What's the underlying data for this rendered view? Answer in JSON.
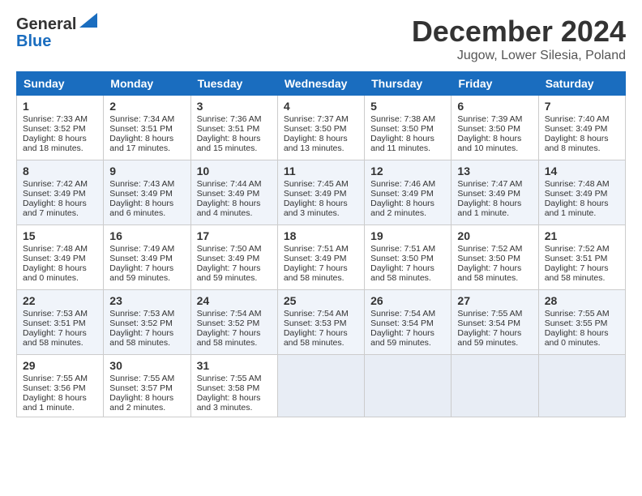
{
  "logo": {
    "general": "General",
    "blue": "Blue"
  },
  "header": {
    "month": "December 2024",
    "location": "Jugow, Lower Silesia, Poland"
  },
  "days_of_week": [
    "Sunday",
    "Monday",
    "Tuesday",
    "Wednesday",
    "Thursday",
    "Friday",
    "Saturday"
  ],
  "weeks": [
    [
      {
        "day": 1,
        "sunrise": "7:33 AM",
        "sunset": "3:52 PM",
        "daylight": "8 hours and 18 minutes."
      },
      {
        "day": 2,
        "sunrise": "7:34 AM",
        "sunset": "3:51 PM",
        "daylight": "8 hours and 17 minutes."
      },
      {
        "day": 3,
        "sunrise": "7:36 AM",
        "sunset": "3:51 PM",
        "daylight": "8 hours and 15 minutes."
      },
      {
        "day": 4,
        "sunrise": "7:37 AM",
        "sunset": "3:50 PM",
        "daylight": "8 hours and 13 minutes."
      },
      {
        "day": 5,
        "sunrise": "7:38 AM",
        "sunset": "3:50 PM",
        "daylight": "8 hours and 11 minutes."
      },
      {
        "day": 6,
        "sunrise": "7:39 AM",
        "sunset": "3:50 PM",
        "daylight": "8 hours and 10 minutes."
      },
      {
        "day": 7,
        "sunrise": "7:40 AM",
        "sunset": "3:49 PM",
        "daylight": "8 hours and 8 minutes."
      }
    ],
    [
      {
        "day": 8,
        "sunrise": "7:42 AM",
        "sunset": "3:49 PM",
        "daylight": "8 hours and 7 minutes."
      },
      {
        "day": 9,
        "sunrise": "7:43 AM",
        "sunset": "3:49 PM",
        "daylight": "8 hours and 6 minutes."
      },
      {
        "day": 10,
        "sunrise": "7:44 AM",
        "sunset": "3:49 PM",
        "daylight": "8 hours and 4 minutes."
      },
      {
        "day": 11,
        "sunrise": "7:45 AM",
        "sunset": "3:49 PM",
        "daylight": "8 hours and 3 minutes."
      },
      {
        "day": 12,
        "sunrise": "7:46 AM",
        "sunset": "3:49 PM",
        "daylight": "8 hours and 2 minutes."
      },
      {
        "day": 13,
        "sunrise": "7:47 AM",
        "sunset": "3:49 PM",
        "daylight": "8 hours and 1 minute."
      },
      {
        "day": 14,
        "sunrise": "7:48 AM",
        "sunset": "3:49 PM",
        "daylight": "8 hours and 1 minute."
      }
    ],
    [
      {
        "day": 15,
        "sunrise": "7:48 AM",
        "sunset": "3:49 PM",
        "daylight": "8 hours and 0 minutes."
      },
      {
        "day": 16,
        "sunrise": "7:49 AM",
        "sunset": "3:49 PM",
        "daylight": "7 hours and 59 minutes."
      },
      {
        "day": 17,
        "sunrise": "7:50 AM",
        "sunset": "3:49 PM",
        "daylight": "7 hours and 59 minutes."
      },
      {
        "day": 18,
        "sunrise": "7:51 AM",
        "sunset": "3:49 PM",
        "daylight": "7 hours and 58 minutes."
      },
      {
        "day": 19,
        "sunrise": "7:51 AM",
        "sunset": "3:50 PM",
        "daylight": "7 hours and 58 minutes."
      },
      {
        "day": 20,
        "sunrise": "7:52 AM",
        "sunset": "3:50 PM",
        "daylight": "7 hours and 58 minutes."
      },
      {
        "day": 21,
        "sunrise": "7:52 AM",
        "sunset": "3:51 PM",
        "daylight": "7 hours and 58 minutes."
      }
    ],
    [
      {
        "day": 22,
        "sunrise": "7:53 AM",
        "sunset": "3:51 PM",
        "daylight": "7 hours and 58 minutes."
      },
      {
        "day": 23,
        "sunrise": "7:53 AM",
        "sunset": "3:52 PM",
        "daylight": "7 hours and 58 minutes."
      },
      {
        "day": 24,
        "sunrise": "7:54 AM",
        "sunset": "3:52 PM",
        "daylight": "7 hours and 58 minutes."
      },
      {
        "day": 25,
        "sunrise": "7:54 AM",
        "sunset": "3:53 PM",
        "daylight": "7 hours and 58 minutes."
      },
      {
        "day": 26,
        "sunrise": "7:54 AM",
        "sunset": "3:54 PM",
        "daylight": "7 hours and 59 minutes."
      },
      {
        "day": 27,
        "sunrise": "7:55 AM",
        "sunset": "3:54 PM",
        "daylight": "7 hours and 59 minutes."
      },
      {
        "day": 28,
        "sunrise": "7:55 AM",
        "sunset": "3:55 PM",
        "daylight": "8 hours and 0 minutes."
      }
    ],
    [
      {
        "day": 29,
        "sunrise": "7:55 AM",
        "sunset": "3:56 PM",
        "daylight": "8 hours and 1 minute."
      },
      {
        "day": 30,
        "sunrise": "7:55 AM",
        "sunset": "3:57 PM",
        "daylight": "8 hours and 2 minutes."
      },
      {
        "day": 31,
        "sunrise": "7:55 AM",
        "sunset": "3:58 PM",
        "daylight": "8 hours and 3 minutes."
      },
      null,
      null,
      null,
      null
    ]
  ],
  "labels": {
    "sunrise": "Sunrise:",
    "sunset": "Sunset:",
    "daylight": "Daylight:"
  }
}
